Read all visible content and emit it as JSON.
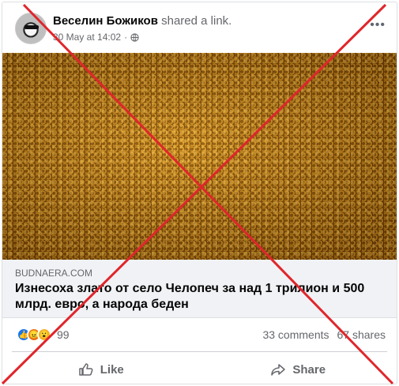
{
  "post": {
    "author": "Веселин Божиков",
    "action": "shared a link.",
    "timestamp": "30 May at 14:02",
    "dot": "·",
    "more_icon": "more-dots-icon",
    "privacy_icon": "globe-icon"
  },
  "link_preview": {
    "domain": "BUDNAERA.COM",
    "headline": "Изнесоха злато от село Челопеч за над 1 трилион и 500 млрд. евро, а народа беден"
  },
  "stats": {
    "reaction_icons": [
      "like-icon",
      "angry-icon",
      "wow-icon"
    ],
    "reaction_count": "99",
    "comments": "33 comments",
    "shares": "67 shares"
  },
  "actions": {
    "like_label": "Like",
    "share_label": "Share"
  },
  "colors": {
    "strike_red": "#e0262b",
    "like_blue": "#1877f2",
    "secondary_text": "#65676b"
  }
}
